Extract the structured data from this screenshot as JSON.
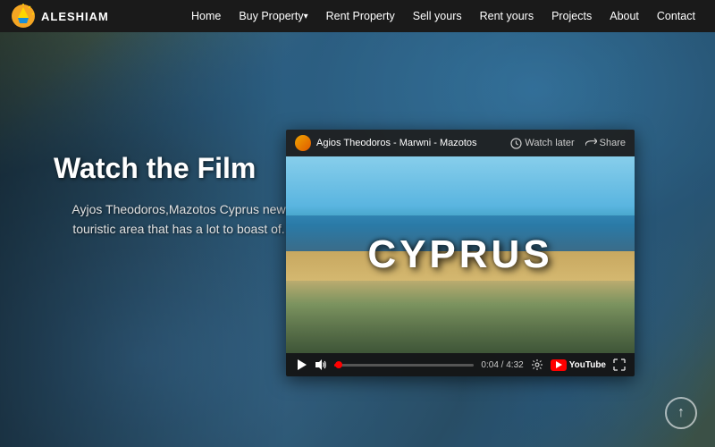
{
  "nav": {
    "logo_text": "ALESHIAM",
    "links": [
      {
        "label": "Home",
        "has_arrow": false,
        "id": "home"
      },
      {
        "label": "Buy Property",
        "has_arrow": true,
        "id": "buy"
      },
      {
        "label": "Rent Property",
        "has_arrow": false,
        "id": "rent"
      },
      {
        "label": "Sell yours",
        "has_arrow": false,
        "id": "sell"
      },
      {
        "label": "Rent yours",
        "has_arrow": false,
        "id": "rent-yours"
      },
      {
        "label": "Projects",
        "has_arrow": false,
        "id": "projects"
      },
      {
        "label": "About",
        "has_arrow": false,
        "id": "about"
      },
      {
        "label": "Contact",
        "has_arrow": false,
        "id": "contact"
      }
    ]
  },
  "hero": {
    "title": "Watch the Film",
    "description": "Ayjos Theodoros,Mazotos Cyprus new touristic area that has a lot to boast of."
  },
  "video": {
    "channel_name": "Agios Theodoros - Marwni - Mazotos",
    "watch_later_label": "Watch later",
    "share_label": "Share",
    "overlay_text": "CYPRUS",
    "time_current": "0:04",
    "time_total": "4:32",
    "youtube_label": "YouTube"
  },
  "scroll": {
    "arrow": "↑"
  }
}
